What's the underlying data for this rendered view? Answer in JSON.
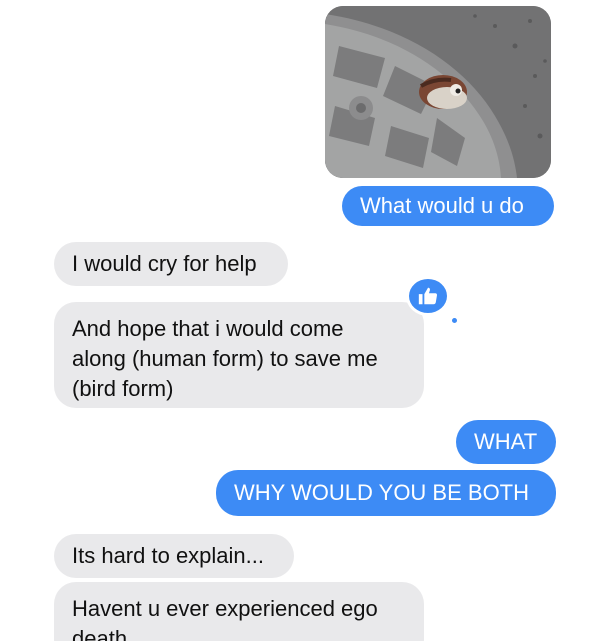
{
  "messages": [
    {
      "text": "What would u do"
    },
    {
      "text": "I would cry for help"
    },
    {
      "lines": [
        "And hope that i would come",
        "along (human form) to save me",
        "(bird form)"
      ]
    },
    {
      "text": "WHAT"
    },
    {
      "text": "WHY WOULD YOU BE BOTH"
    },
    {
      "text": "Its hard to explain..."
    },
    {
      "lines": [
        "Havent u ever experienced ego",
        "death"
      ]
    }
  ],
  "photo": {
    "subject": "sparrow on manhole cover"
  },
  "tapback": {
    "icon": "thumbs-up-icon"
  },
  "colors": {
    "sent": "#3d8bf5",
    "received": "#e9e9eb"
  }
}
